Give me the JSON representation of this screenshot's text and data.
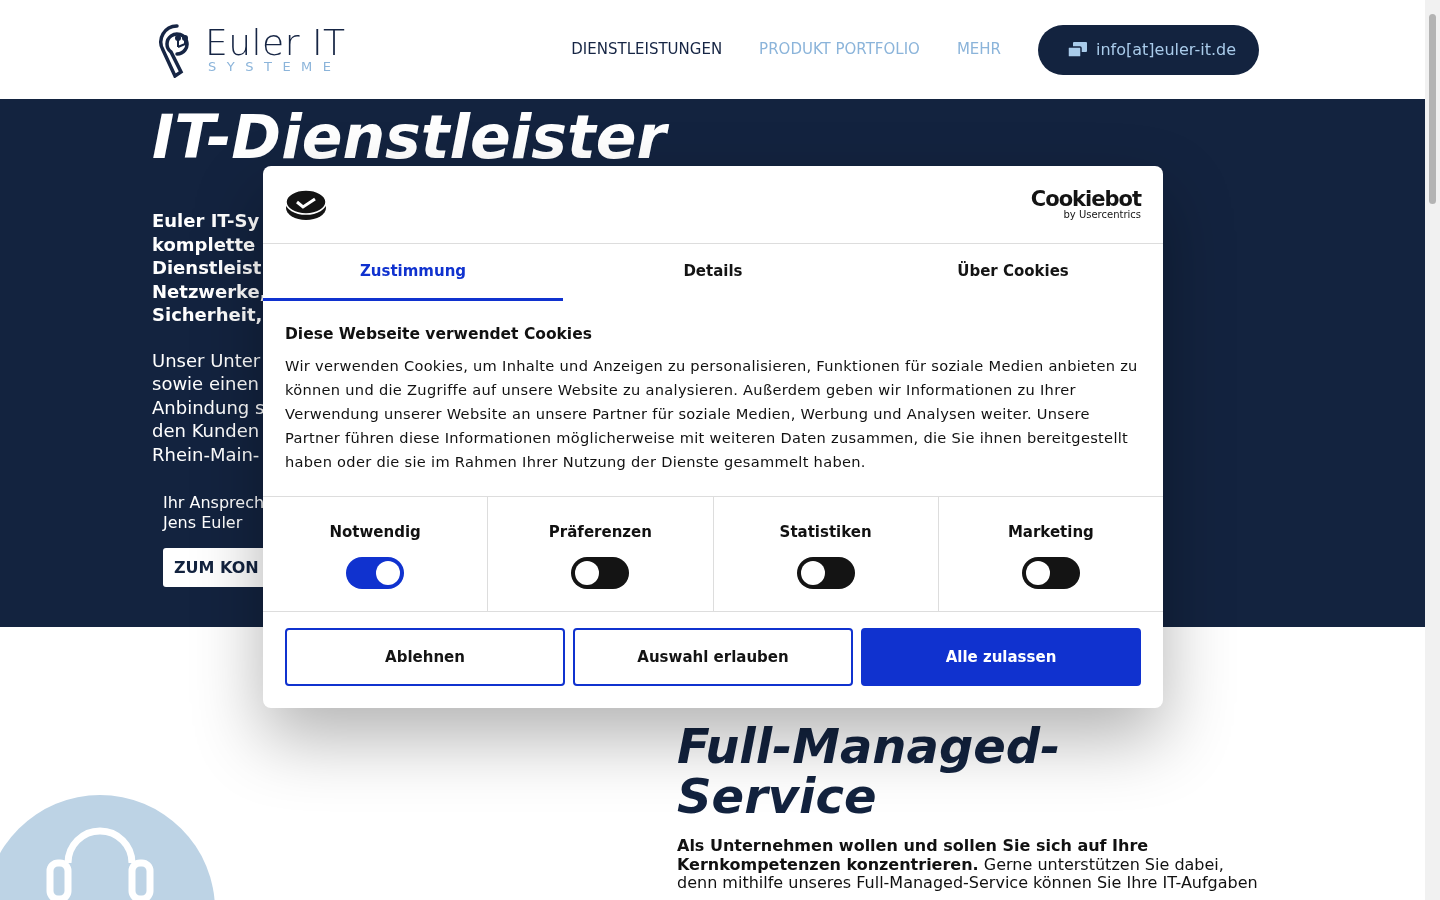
{
  "header": {
    "logo": {
      "name": "Euler IT",
      "tagline": "SYSTEME"
    },
    "nav": [
      {
        "label": "DIENSTLEISTUNGEN",
        "selected": true
      },
      {
        "label": "PRODUKT PORTFOLIO",
        "selected": false
      },
      {
        "label": "MEHR",
        "selected": false
      }
    ],
    "email_button": "info[at]euler-it.de"
  },
  "hero": {
    "title": "IT-Dienstleister",
    "intro_lines": [
      "Euler IT-Sy",
      "komplette",
      "Dienstleist",
      "Netzwerke,",
      "Sicherheit,"
    ],
    "body_lines": [
      "Unser Unter",
      "sowie einen",
      "Anbindung s",
      "den Kunden",
      "Rhein-Main-"
    ],
    "contact_lines": [
      "Ihr Ansprech",
      "Jens Euler"
    ],
    "button": "ZUM KON"
  },
  "section": {
    "title_lines": [
      "Full-Managed-",
      "Service"
    ],
    "text": "**Als Unternehmen wollen und sollen Sie sich auf Ihre Kernkompetenzen konzentrieren.** Gerne unterstützen Sie dabei, denn mithilfe unseres Full-Managed-Service können Sie Ihre IT-Aufgaben"
  },
  "cookie_dialog": {
    "brand": {
      "name": "Cookiebot",
      "by": "by Usercentrics"
    },
    "tabs": [
      {
        "label": "Zustimmung",
        "selected": true
      },
      {
        "label": "Details",
        "selected": false
      },
      {
        "label": "Über Cookies",
        "selected": false
      }
    ],
    "heading": "Diese Webseite verwendet Cookies",
    "text": "Wir verwenden Cookies, um Inhalte und Anzeigen zu personalisieren, Funktionen für soziale Medien anbieten zu können und die Zugriffe auf unsere Website zu analysieren. Außerdem geben wir Informationen zu Ihrer Verwendung unserer Website an unsere Partner für soziale Medien, Werbung und Analysen weiter. Unsere Partner führen diese Informationen möglicherweise mit weiteren Daten zusammen, die Sie ihnen bereitgestellt haben oder die sie im Rahmen Ihrer Nutzung der Dienste gesammelt haben.",
    "categories": [
      {
        "label": "Notwendig",
        "checked": true
      },
      {
        "label": "Präferenzen",
        "checked": false
      },
      {
        "label": "Statistiken",
        "checked": false
      },
      {
        "label": "Marketing",
        "checked": false
      }
    ],
    "buttons": [
      {
        "label": "Ablehnen",
        "kind": "outline"
      },
      {
        "label": "Auswahl erlauben",
        "kind": "outline"
      },
      {
        "label": "Alle zulassen",
        "kind": "primary"
      }
    ]
  }
}
